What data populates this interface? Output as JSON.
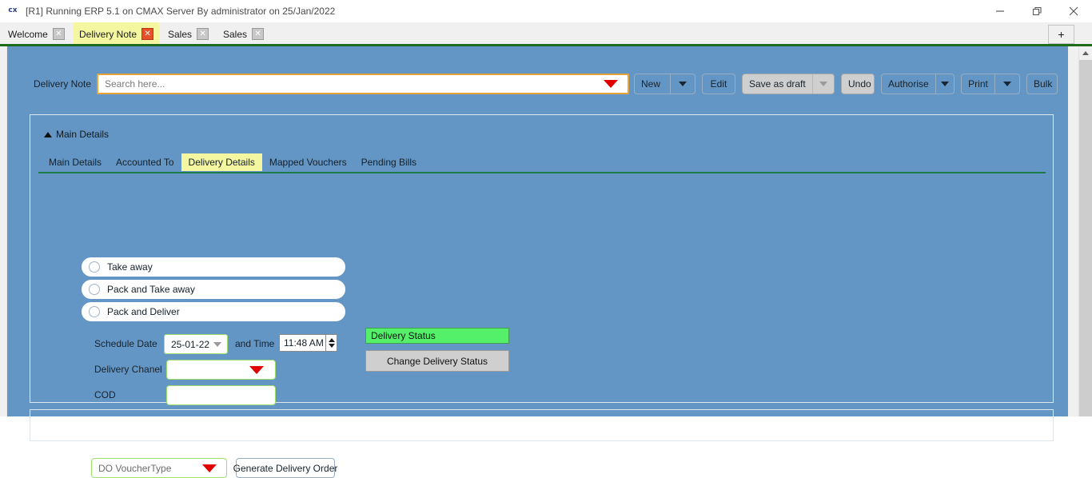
{
  "window": {
    "title": "[R1] Running ERP 5.1 on CMAX Server By administrator on 25/Jan/2022",
    "app_glyph": "cx",
    "minimize_icon": "minimize-icon",
    "maximize_icon": "restore-icon",
    "close_icon": "close-icon"
  },
  "tabbar": {
    "tabs": [
      {
        "label": "Welcome",
        "active": false,
        "close": "✕"
      },
      {
        "label": "Delivery Note",
        "active": true,
        "close": "✕"
      },
      {
        "label": "Sales",
        "active": false,
        "close": "✕"
      },
      {
        "label": "Sales",
        "active": false,
        "close": "✕"
      }
    ],
    "new_tab_label": "+"
  },
  "toolbar": {
    "form_label": "Delivery Note",
    "search_placeholder": "Search here...",
    "search_value": "",
    "buttons": {
      "new": "New",
      "edit": "Edit",
      "save_as_draft": "Save as draft",
      "undo": "Undo",
      "authorise": "Authorise",
      "print": "Print",
      "bulk": "Bulk"
    }
  },
  "main_card": {
    "header": "Main Details",
    "collapse_icon": "triangle-up-icon",
    "subtabs": [
      {
        "label": "Main Details",
        "active": false
      },
      {
        "label": "Accounted To",
        "active": false
      },
      {
        "label": "Delivery Details",
        "active": true
      },
      {
        "label": "Mapped Vouchers",
        "active": false
      },
      {
        "label": "Pending Bills",
        "active": false
      }
    ]
  },
  "delivery_details": {
    "options": [
      {
        "label": "Take away",
        "selected": false
      },
      {
        "label": "Pack and Take away",
        "selected": false
      },
      {
        "label": "Pack and Deliver",
        "selected": false
      }
    ],
    "fields": {
      "schedule_date_label": "Schedule Date",
      "schedule_date_value": "25-01-22",
      "and_time_label": "and Time",
      "time_value": "11:48 AM",
      "delivery_chanel_label": "Delivery Chanel",
      "delivery_chanel_value": "",
      "cod_label": "COD",
      "cod_value": ""
    },
    "status": {
      "bar_label": "Delivery Status",
      "change_button": "Change Delivery Status",
      "bar_color": "#55f06a"
    },
    "voucher": {
      "type_value": "DO VoucherType",
      "generate_button": "Generate Delivery Order"
    }
  },
  "colors": {
    "app_background": "#6496c5",
    "accent_green_rule": "#1d6b1d",
    "active_tab": "#f4f6a0",
    "search_border": "#e8a33d",
    "field_border_green": "#9ee06a",
    "caret_red": "#e00000"
  }
}
